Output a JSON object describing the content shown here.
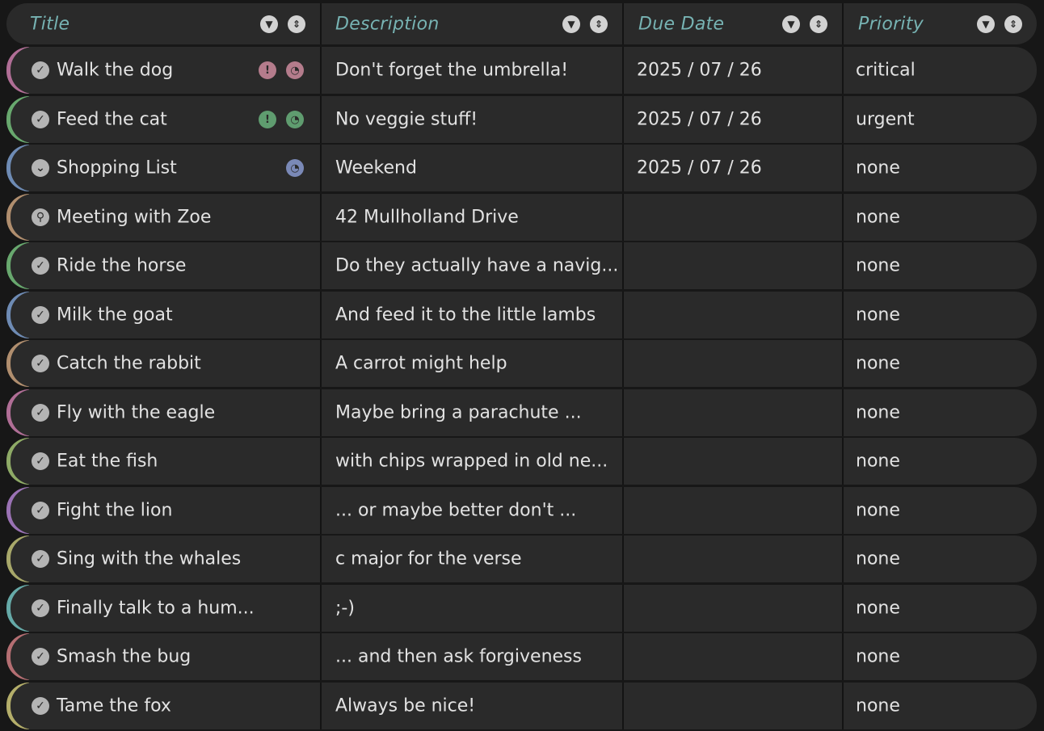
{
  "header": {
    "title": "Title",
    "description": "Description",
    "due_date": "Due Date",
    "priority": "Priority",
    "filter_icon_glyph": "▼",
    "sort_icon_glyph": "⇕"
  },
  "colors": {
    "row_bg": "#2a2a2a",
    "header_text": "#77b3b3",
    "cell_text": "#e2e2e2",
    "separator": "#141414"
  },
  "rows": [
    {
      "title": "Walk the dog",
      "description": "Don't forget the umbrella!",
      "due": "2025 / 07 / 26",
      "priority": "critical",
      "color": "#b06e96",
      "status": "check-icon",
      "badges": [
        {
          "icon": "exclamation-icon",
          "color": "#b47c8c"
        },
        {
          "icon": "alarm-icon",
          "color": "#b47c8c"
        }
      ]
    },
    {
      "title": "Feed the cat",
      "description": "No veggie stuff!",
      "due": "2025 / 07 / 26",
      "priority": "urgent",
      "color": "#68a86e",
      "status": "check-icon",
      "badges": [
        {
          "icon": "exclamation-icon",
          "color": "#5f9c6f"
        },
        {
          "icon": "alarm-icon",
          "color": "#5f9c6f"
        }
      ]
    },
    {
      "title": "Shopping List",
      "description": "Weekend",
      "due": "2025 / 07 / 26",
      "priority": "none",
      "color": "#6e8bb4",
      "status": "chevrons-down-icon",
      "badges": [
        {
          "icon": "alarm-icon",
          "color": "#7a89b7"
        }
      ]
    },
    {
      "title": "Meeting with Zoe",
      "description": "42 Mullholland Drive",
      "due": "",
      "priority": "none",
      "color": "#b08e6e",
      "status": "pin-icon",
      "badges": []
    },
    {
      "title": "Ride the horse",
      "description": "Do they actually have a navig...",
      "due": "",
      "priority": "none",
      "color": "#68a86e",
      "status": "check-icon",
      "badges": []
    },
    {
      "title": "Milk the goat",
      "description": "And feed it to the little lambs",
      "due": "",
      "priority": "none",
      "color": "#6e8bb4",
      "status": "check-icon",
      "badges": []
    },
    {
      "title": "Catch the rabbit",
      "description": "A carrot might help",
      "due": "",
      "priority": "none",
      "color": "#b08e6e",
      "status": "check-icon",
      "badges": []
    },
    {
      "title": "Fly with the eagle",
      "description": "Maybe bring a parachute ...",
      "due": "",
      "priority": "none",
      "color": "#b06e96",
      "status": "check-icon",
      "badges": []
    },
    {
      "title": "Eat the fish",
      "description": "with chips wrapped in old ne...",
      "due": "",
      "priority": "none",
      "color": "#8eaa66",
      "status": "check-icon",
      "badges": []
    },
    {
      "title": "Fight the lion",
      "description": "... or maybe better don't ...",
      "due": "",
      "priority": "none",
      "color": "#9a72b4",
      "status": "check-icon",
      "badges": []
    },
    {
      "title": "Sing with the whales",
      "description": "c major for the verse",
      "due": "",
      "priority": "none",
      "color": "#a8a86a",
      "status": "check-icon",
      "badges": []
    },
    {
      "title": "Finally talk to a hum...",
      "description": ";-)",
      "due": "",
      "priority": "none",
      "color": "#66aaa8",
      "status": "check-icon",
      "badges": []
    },
    {
      "title": "Smash the bug",
      "description": "... and then ask forgiveness",
      "due": "",
      "priority": "none",
      "color": "#b46e72",
      "status": "check-icon",
      "badges": []
    },
    {
      "title": "Tame the fox",
      "description": "Always be nice!",
      "due": "",
      "priority": "none",
      "color": "#b4ae6a",
      "status": "check-icon",
      "badges": []
    }
  ]
}
